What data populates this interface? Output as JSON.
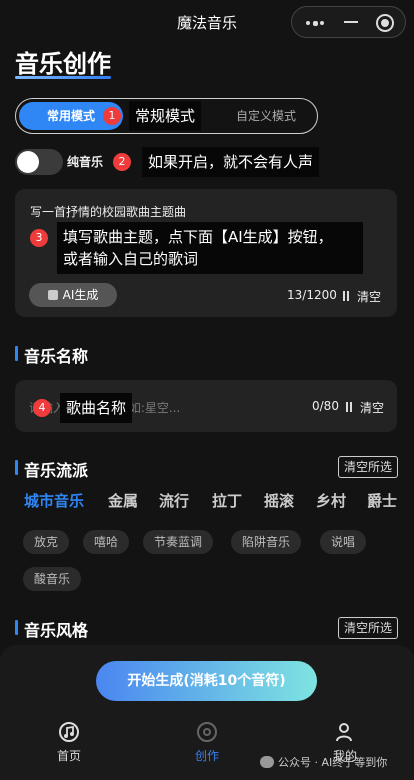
{
  "topbar": {
    "title": "魔法音乐"
  },
  "page": {
    "title": "音乐创作"
  },
  "mode_switch": {
    "common": "常用模式",
    "custom": "自定义模式"
  },
  "pure_music": {
    "label": "纯音乐",
    "enabled": false
  },
  "lyric": {
    "prompt": "写一首抒情的校园歌曲主题曲",
    "ai_button": "AI生成",
    "counter": "13/1200",
    "clear": "清空"
  },
  "music_name": {
    "section_title": "音乐名称",
    "placeholder": "请输入音乐名称,列如:星空...",
    "counter": "0/80",
    "clear": "清空"
  },
  "genre": {
    "section_title": "音乐流派",
    "clear_selected": "清空所选",
    "tabs": [
      "城市音乐",
      "金属",
      "流行",
      "拉丁",
      "摇滚",
      "乡村",
      "爵士"
    ],
    "active_tab": 0,
    "chips": [
      "放克",
      "嘻哈",
      "节奏蓝调",
      "陷阱音乐",
      "说唱",
      "酸音乐"
    ]
  },
  "style": {
    "section_title": "音乐风格",
    "clear_selected": "清空所选"
  },
  "generate_button": "开始生成(消耗10个音符)",
  "bottom_nav": [
    {
      "label": "首页",
      "icon": "music-note-icon"
    },
    {
      "label": "创作",
      "icon": "disc-icon",
      "active": true
    },
    {
      "label": "我的",
      "icon": "user-icon"
    }
  ],
  "annotations": [
    {
      "num": "1",
      "text": "常规模式"
    },
    {
      "num": "2",
      "text": "如果开启，就不会有人声"
    },
    {
      "num": "3",
      "text": "填写歌曲主题，点下面【AI生成】按钮，\n或者输入自己的歌词"
    },
    {
      "num": "4",
      "text": "歌曲名称"
    }
  ],
  "watermark": "公众号 · AI终于等到你"
}
